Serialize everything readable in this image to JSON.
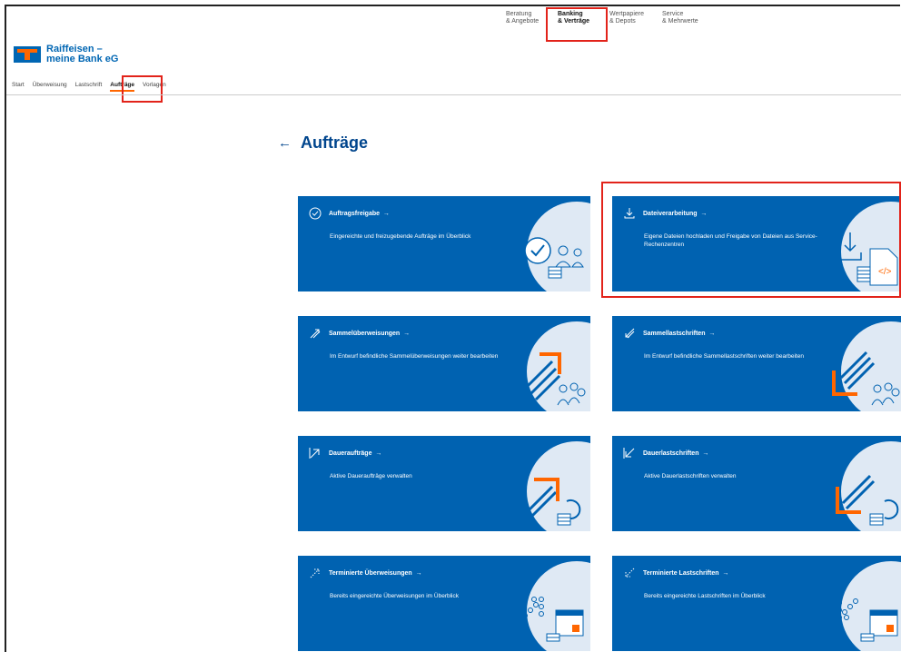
{
  "topnav": [
    {
      "label": "Beratung\n& Angebote",
      "active": false
    },
    {
      "label": "Banking\n& Verträge",
      "active": true
    },
    {
      "label": "Wertpapiere\n& Depots",
      "active": false
    },
    {
      "label": "Service\n& Mehrwerte",
      "active": false
    }
  ],
  "brand": {
    "line1": "Raiffeisen –",
    "line2": "meine Bank eG"
  },
  "subnav": [
    {
      "label": "Start"
    },
    {
      "label": "Überweisung"
    },
    {
      "label": "Lastschrift"
    },
    {
      "label": "Aufträge"
    },
    {
      "label": "Vorlagen"
    }
  ],
  "page": {
    "back": "←",
    "title": "Aufträge"
  },
  "tiles": [
    {
      "title": "Auftragsfreigabe",
      "arrow": "→",
      "desc": "Eingereichte und freizugebende Aufträge im Überblick",
      "icon": "check-circle-icon"
    },
    {
      "title": "Dateiverarbeitung",
      "arrow": "→",
      "desc": "Eigene Dateien hochladen und Freigabe von Dateien aus Service-Rechenzentren",
      "icon": "download-icon"
    },
    {
      "title": "Sammelüberweisungen",
      "arrow": "→",
      "desc": "Im Entwurf befindliche Sammelüberweisungen weiter bearbeiten",
      "icon": "multi-arrow-up-icon"
    },
    {
      "title": "Sammellastschriften",
      "arrow": "→",
      "desc": "Im Entwurf befindliche Sammellastschriften weiter bearbeiten",
      "icon": "multi-arrow-down-icon"
    },
    {
      "title": "Daueraufträge",
      "arrow": "→",
      "desc": "Aktive Daueraufträge verwalten",
      "icon": "arrow-up-right-icon"
    },
    {
      "title": "Dauerlastschriften",
      "arrow": "→",
      "desc": "Aktive Dauerlastschriften verwalten",
      "icon": "arrow-down-left-icon"
    },
    {
      "title": "Terminierte Überweisungen",
      "arrow": "→",
      "desc": "Bereits eingereichte Überweisungen im Überblick",
      "icon": "dotted-arrow-up-icon"
    },
    {
      "title": "Terminierte Lastschriften",
      "arrow": "→",
      "desc": "Bereits eingereichte Lastschriften im Überblick",
      "icon": "dotted-arrow-down-icon"
    }
  ],
  "colors": {
    "brand_blue": "#0062b1",
    "orange": "#ff6600",
    "highlight": "#e2231a"
  }
}
